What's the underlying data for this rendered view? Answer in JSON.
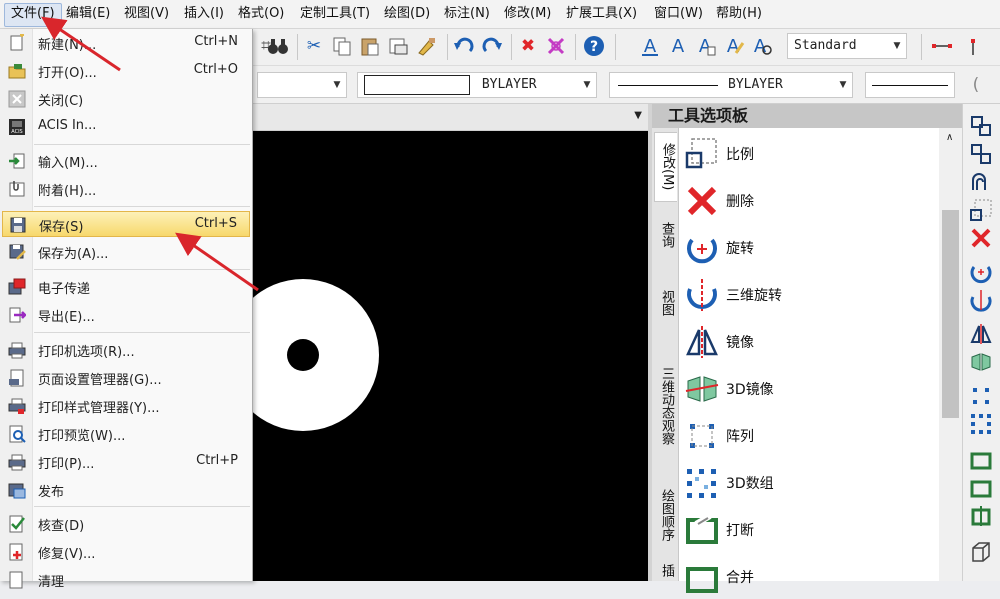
{
  "menubar": {
    "items": [
      "文件(F)",
      "编辑(E)",
      "视图(V)",
      "插入(I)",
      "格式(O)",
      "定制工具(T)",
      "绘图(D)",
      "标注(N)",
      "修改(M)",
      "扩展工具(X)",
      "窗口(W)",
      "帮助(H)"
    ],
    "active": "文件(F)"
  },
  "file_menu": {
    "items": [
      {
        "label": "新建(N)...",
        "shortcut": "Ctrl+N",
        "icon": "new-file-icon"
      },
      {
        "label": "打开(O)...",
        "shortcut": "Ctrl+O",
        "icon": "open-folder-icon"
      },
      {
        "label": "关闭(C)",
        "shortcut": "",
        "icon": "close-icon"
      },
      {
        "label": "ACIS In...",
        "shortcut": "",
        "icon": "acis-icon"
      },
      {
        "label": "输入(M)...",
        "shortcut": "",
        "icon": "import-icon"
      },
      {
        "label": "附着(H)...",
        "shortcut": "",
        "icon": "attach-icon"
      },
      {
        "label": "保存(S)",
        "shortcut": "Ctrl+S",
        "icon": "save-icon",
        "highlighted": true
      },
      {
        "label": "保存为(A)...",
        "shortcut": "",
        "icon": "save-as-icon"
      },
      {
        "label": "电子传递",
        "shortcut": "",
        "icon": "etransmit-icon"
      },
      {
        "label": "导出(E)...",
        "shortcut": "",
        "icon": "export-icon"
      },
      {
        "label": "打印机选项(R)...",
        "shortcut": "",
        "icon": "printer-options-icon"
      },
      {
        "label": "页面设置管理器(G)...",
        "shortcut": "",
        "icon": "page-setup-icon"
      },
      {
        "label": "打印样式管理器(Y)...",
        "shortcut": "",
        "icon": "plot-style-icon"
      },
      {
        "label": "打印预览(W)...",
        "shortcut": "",
        "icon": "print-preview-icon"
      },
      {
        "label": "打印(P)...",
        "shortcut": "Ctrl+P",
        "icon": "print-icon"
      },
      {
        "label": "发布",
        "shortcut": "",
        "icon": "publish-icon"
      },
      {
        "label": "核查(D)",
        "shortcut": "",
        "icon": "audit-icon"
      },
      {
        "label": "修复(V)...",
        "shortcut": "",
        "icon": "recover-icon"
      },
      {
        "label": "清理",
        "shortcut": "",
        "icon": "purge-icon"
      }
    ]
  },
  "toolbar": {
    "text_style": "Standard"
  },
  "properties": {
    "color": "BYLAYER",
    "linetype": "BYLAYER"
  },
  "palette": {
    "title": "工具选项板",
    "tabs": [
      "修改(M)",
      "查询",
      "视图",
      "三维动态观察",
      "绘图顺序",
      "插"
    ],
    "active_tab": "修改(M)",
    "items": [
      {
        "label": "比例",
        "icon": "scale-icon"
      },
      {
        "label": "删除",
        "icon": "delete-icon"
      },
      {
        "label": "旋转",
        "icon": "rotate-icon"
      },
      {
        "label": "三维旋转",
        "icon": "rotate-3d-icon"
      },
      {
        "label": "镜像",
        "icon": "mirror-icon"
      },
      {
        "label": "3D镜像",
        "icon": "mirror-3d-icon"
      },
      {
        "label": "阵列",
        "icon": "array-icon"
      },
      {
        "label": "3D数组",
        "icon": "array-3d-icon"
      },
      {
        "label": "打断",
        "icon": "break-icon"
      },
      {
        "label": "合并",
        "icon": "join-icon"
      }
    ]
  },
  "colors": {
    "canvas": "#000000",
    "highlight": "#f7d86c",
    "annotation_arrow": "#d9262c",
    "icon_blue": "#1d5fb3",
    "icon_red": "#e0262a"
  }
}
